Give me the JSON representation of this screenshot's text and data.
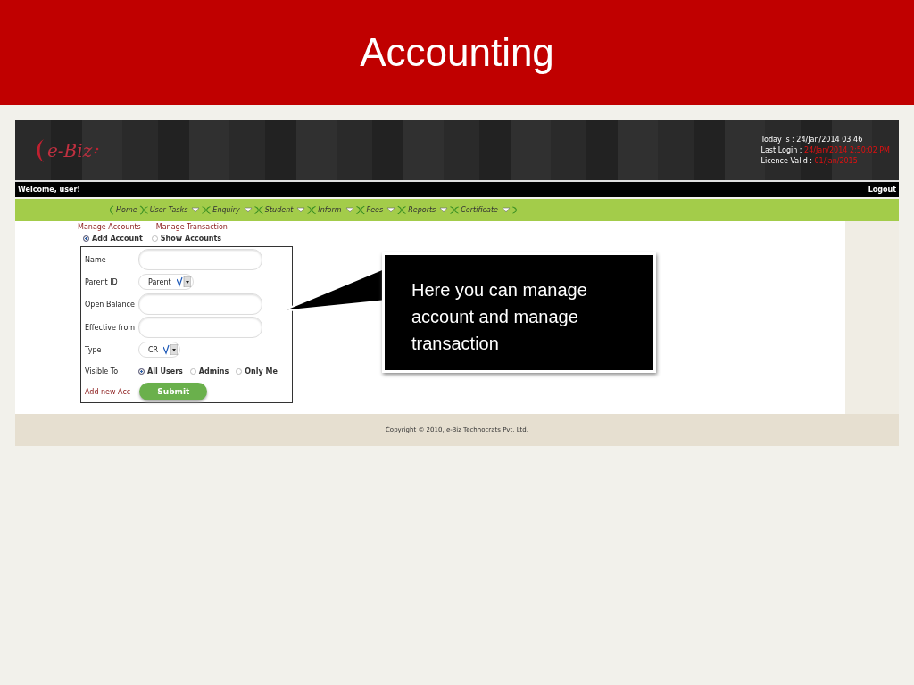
{
  "slide": {
    "title": "Accounting"
  },
  "header": {
    "logo": "e-Biz",
    "info": [
      {
        "label": "Today is : ",
        "value": "24/Jan/2014 03:46",
        "highlight": false
      },
      {
        "label": "Last Login : ",
        "value": "24/Jan/2014 2:50:02 PM",
        "highlight": true
      },
      {
        "label": "Licence Valid : ",
        "value": "01/Jan/2015",
        "highlight": true
      }
    ]
  },
  "welcome": "Welcome,  user!",
  "logout": "Logout",
  "nav": [
    {
      "label": "Home",
      "dropdown": false
    },
    {
      "label": "User Tasks",
      "dropdown": true
    },
    {
      "label": "Enquiry",
      "dropdown": true
    },
    {
      "label": "Student",
      "dropdown": true
    },
    {
      "label": "Inform",
      "dropdown": true
    },
    {
      "label": "Fees",
      "dropdown": true
    },
    {
      "label": "Reports",
      "dropdown": true
    },
    {
      "label": "Certificate",
      "dropdown": true
    }
  ],
  "sub_links": [
    "Manage Accounts",
    "Manage Transaction"
  ],
  "mode": [
    {
      "label": "Add Account",
      "selected": true
    },
    {
      "label": "Show Accounts",
      "selected": false
    }
  ],
  "form": {
    "rows": [
      {
        "kind": "text",
        "label": "Name"
      },
      {
        "kind": "select",
        "label": "Parent ID",
        "value": "Parent"
      },
      {
        "kind": "text",
        "label": "Open Balance"
      },
      {
        "kind": "text",
        "label": "Effective from"
      },
      {
        "kind": "select",
        "label": "Type",
        "value": "CR"
      },
      {
        "kind": "radio",
        "label": "Visible To",
        "options": [
          {
            "label": "All Users",
            "selected": true
          },
          {
            "label": "Admins",
            "selected": false
          },
          {
            "label": "Only Me",
            "selected": false
          }
        ]
      }
    ],
    "link": "Add new Acc",
    "submit": "Submit"
  },
  "callout": "Here you can manage account and manage transaction",
  "footer": "Copyright © 2010, e-Biz Technocrats Pvt. Ltd."
}
